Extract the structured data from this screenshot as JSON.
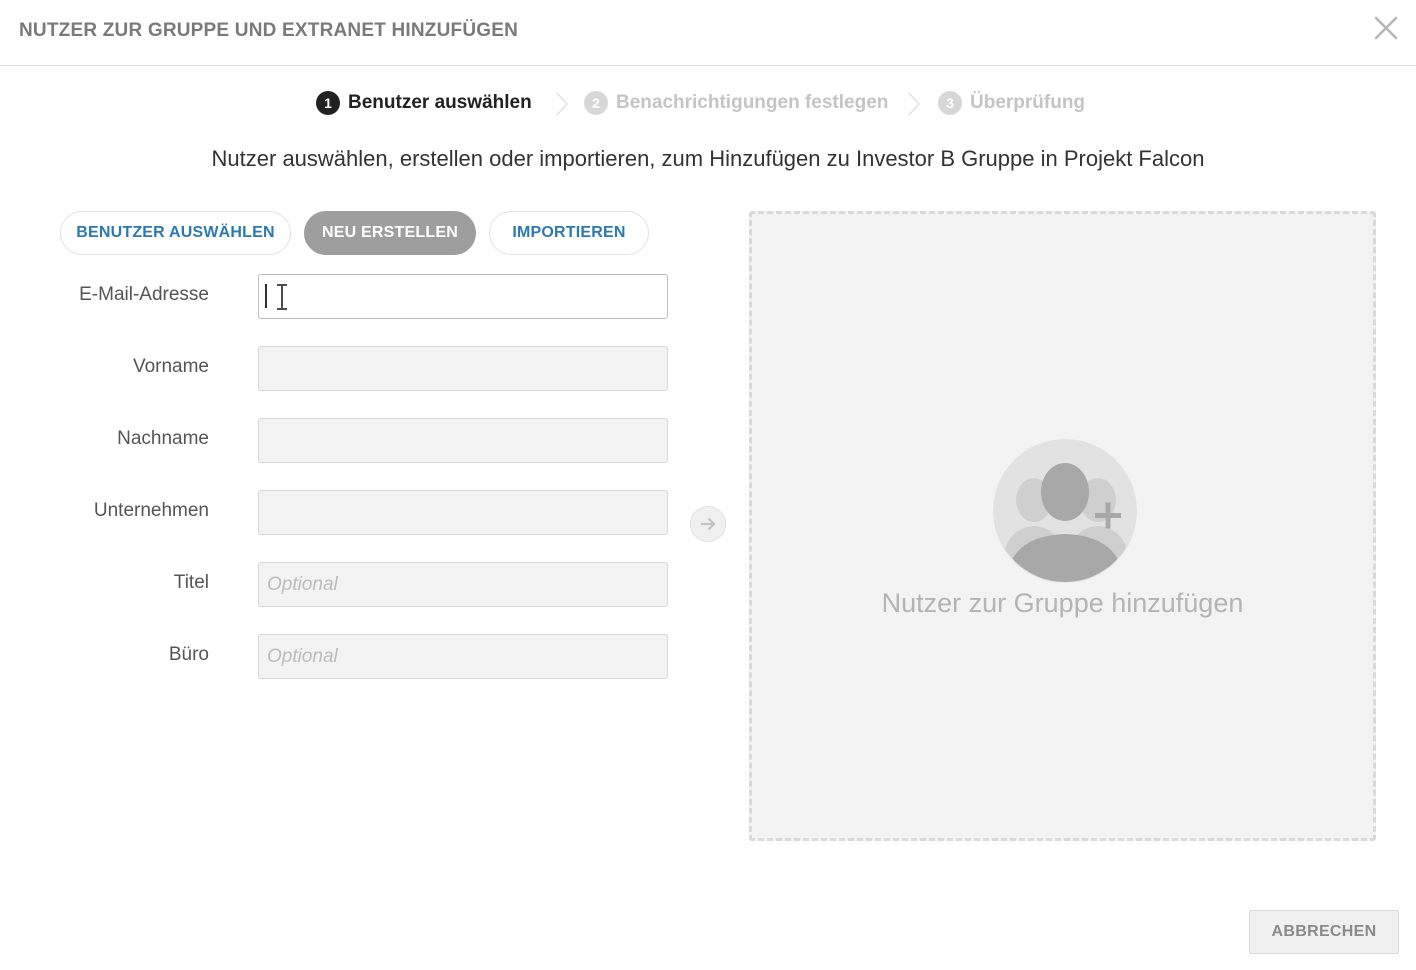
{
  "dialog": {
    "title": "NUTZER ZUR GRUPPE UND EXTRANET HINZUFÜGEN",
    "close_icon": "close-icon"
  },
  "steps": [
    {
      "number": "1",
      "label": "Benutzer auswählen",
      "state": "active"
    },
    {
      "number": "2",
      "label": "Benachrichtigungen festlegen",
      "state": "inactive"
    },
    {
      "number": "3",
      "label": "Überprüfung",
      "state": "inactive"
    }
  ],
  "subtitle": "Nutzer auswählen, erstellen oder importieren, zum Hinzufügen zu Investor B Gruppe in Projekt Falcon",
  "mode_tabs": {
    "select": "BENUTZER AUSWÄHLEN",
    "create": "NEU ERSTELLEN",
    "import": "IMPORTIEREN",
    "selected": "create"
  },
  "form": {
    "email": {
      "label": "E-Mail-Adresse",
      "value": "",
      "placeholder": ""
    },
    "first_name": {
      "label": "Vorname",
      "value": "",
      "placeholder": ""
    },
    "last_name": {
      "label": "Nachname",
      "value": "",
      "placeholder": ""
    },
    "company": {
      "label": "Unternehmen",
      "value": "",
      "placeholder": ""
    },
    "title": {
      "label": "Titel",
      "value": "",
      "placeholder": "Optional"
    },
    "office": {
      "label": "Büro",
      "value": "",
      "placeholder": "Optional"
    }
  },
  "add_arrow_icon": "arrow-right-icon",
  "dropzone": {
    "icon": "add-users-icon",
    "text": "Nutzer zur Gruppe hinzufügen"
  },
  "footer": {
    "cancel_label": "ABBRECHEN"
  },
  "colors": {
    "link_blue": "#2a7ab0",
    "selected_pill": "#9e9e9e",
    "input_bg": "#f3f3f4",
    "header_text": "#7a7a7a"
  }
}
